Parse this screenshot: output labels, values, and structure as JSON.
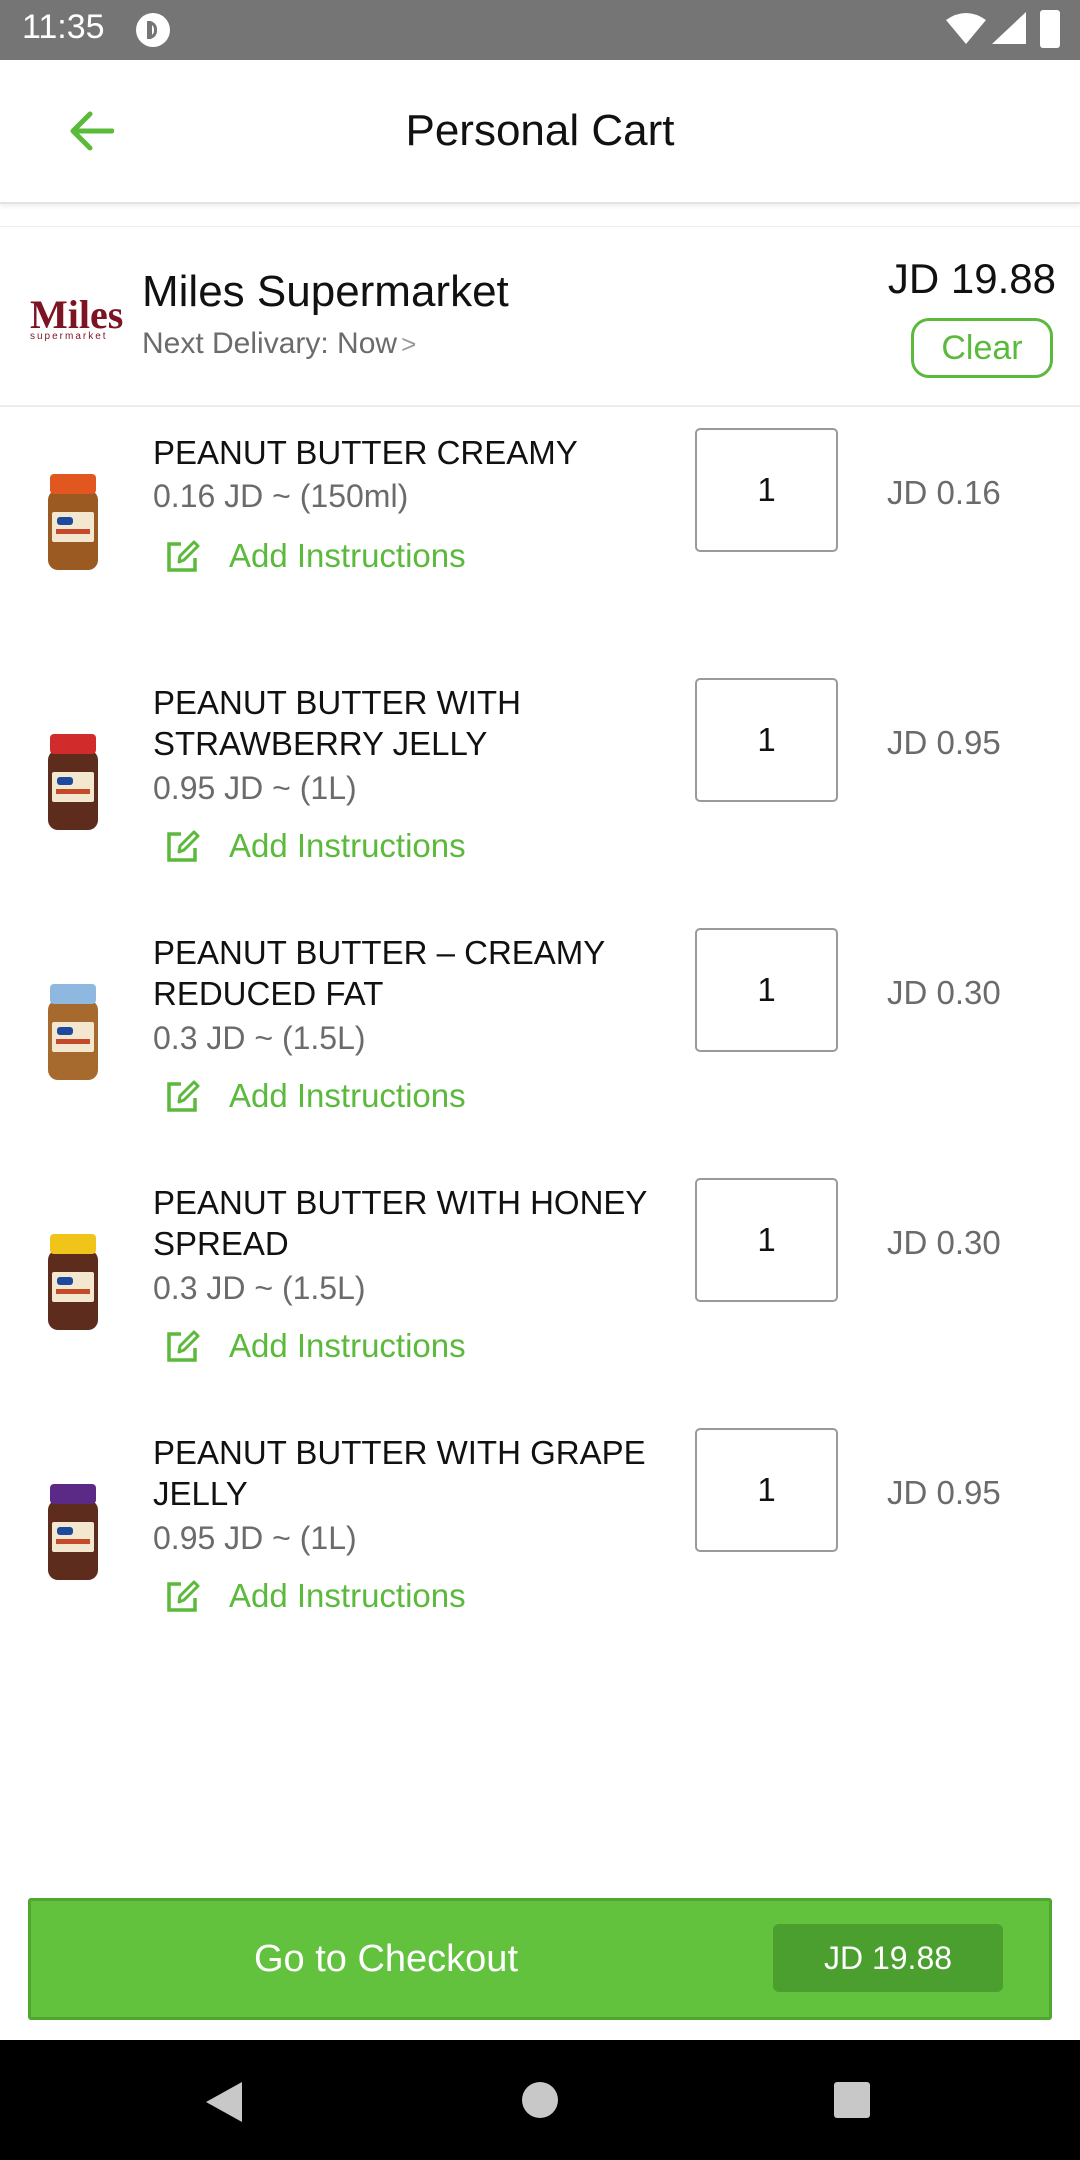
{
  "status_bar": {
    "time": "11:35"
  },
  "header": {
    "title": "Personal Cart"
  },
  "store": {
    "logo_text": "Miles",
    "logo_sub": "supermarket",
    "name": "Miles Supermarket",
    "delivery": "Next Delivary: Now",
    "total": "JD 19.88",
    "clear_label": "Clear"
  },
  "items": [
    {
      "name": "PEANUT BUTTER CREAMY",
      "unit": "0.16 JD ~ (150ml)",
      "instructions_label": "Add Instructions",
      "quantity": "1",
      "price": "JD 0.16",
      "lid_color": "#e2571f"
    },
    {
      "name": "PEANUT BUTTER WITH STRAWBERRY JELLY",
      "unit": "0.95 JD ~ (1L)",
      "instructions_label": "Add Instructions",
      "quantity": "1",
      "price": "JD 0.95",
      "lid_color": "#d12b2b"
    },
    {
      "name": "PEANUT BUTTER – CREAMY REDUCED FAT",
      "unit": "0.3 JD ~ (1.5L)",
      "instructions_label": "Add Instructions",
      "quantity": "1",
      "price": "JD 0.30",
      "lid_color": "#8fb8e0"
    },
    {
      "name": "PEANUT BUTTER WITH HONEY SPREAD",
      "unit": "0.3 JD ~ (1.5L)",
      "instructions_label": "Add Instructions",
      "quantity": "1",
      "price": "JD 0.30",
      "lid_color": "#f0c419"
    },
    {
      "name": "PEANUT BUTTER WITH GRAPE JELLY",
      "unit": "0.95 JD ~ (1L)",
      "instructions_label": "Add Instructions",
      "quantity": "1",
      "price": "JD 0.95",
      "lid_color": "#5b2a86"
    }
  ],
  "checkout": {
    "label": "Go to Checkout",
    "amount": "JD 19.88"
  },
  "colors": {
    "accent": "#5bb93b",
    "checkout_bg": "#62c13d",
    "checkout_amount_bg": "#4a9f2e"
  }
}
